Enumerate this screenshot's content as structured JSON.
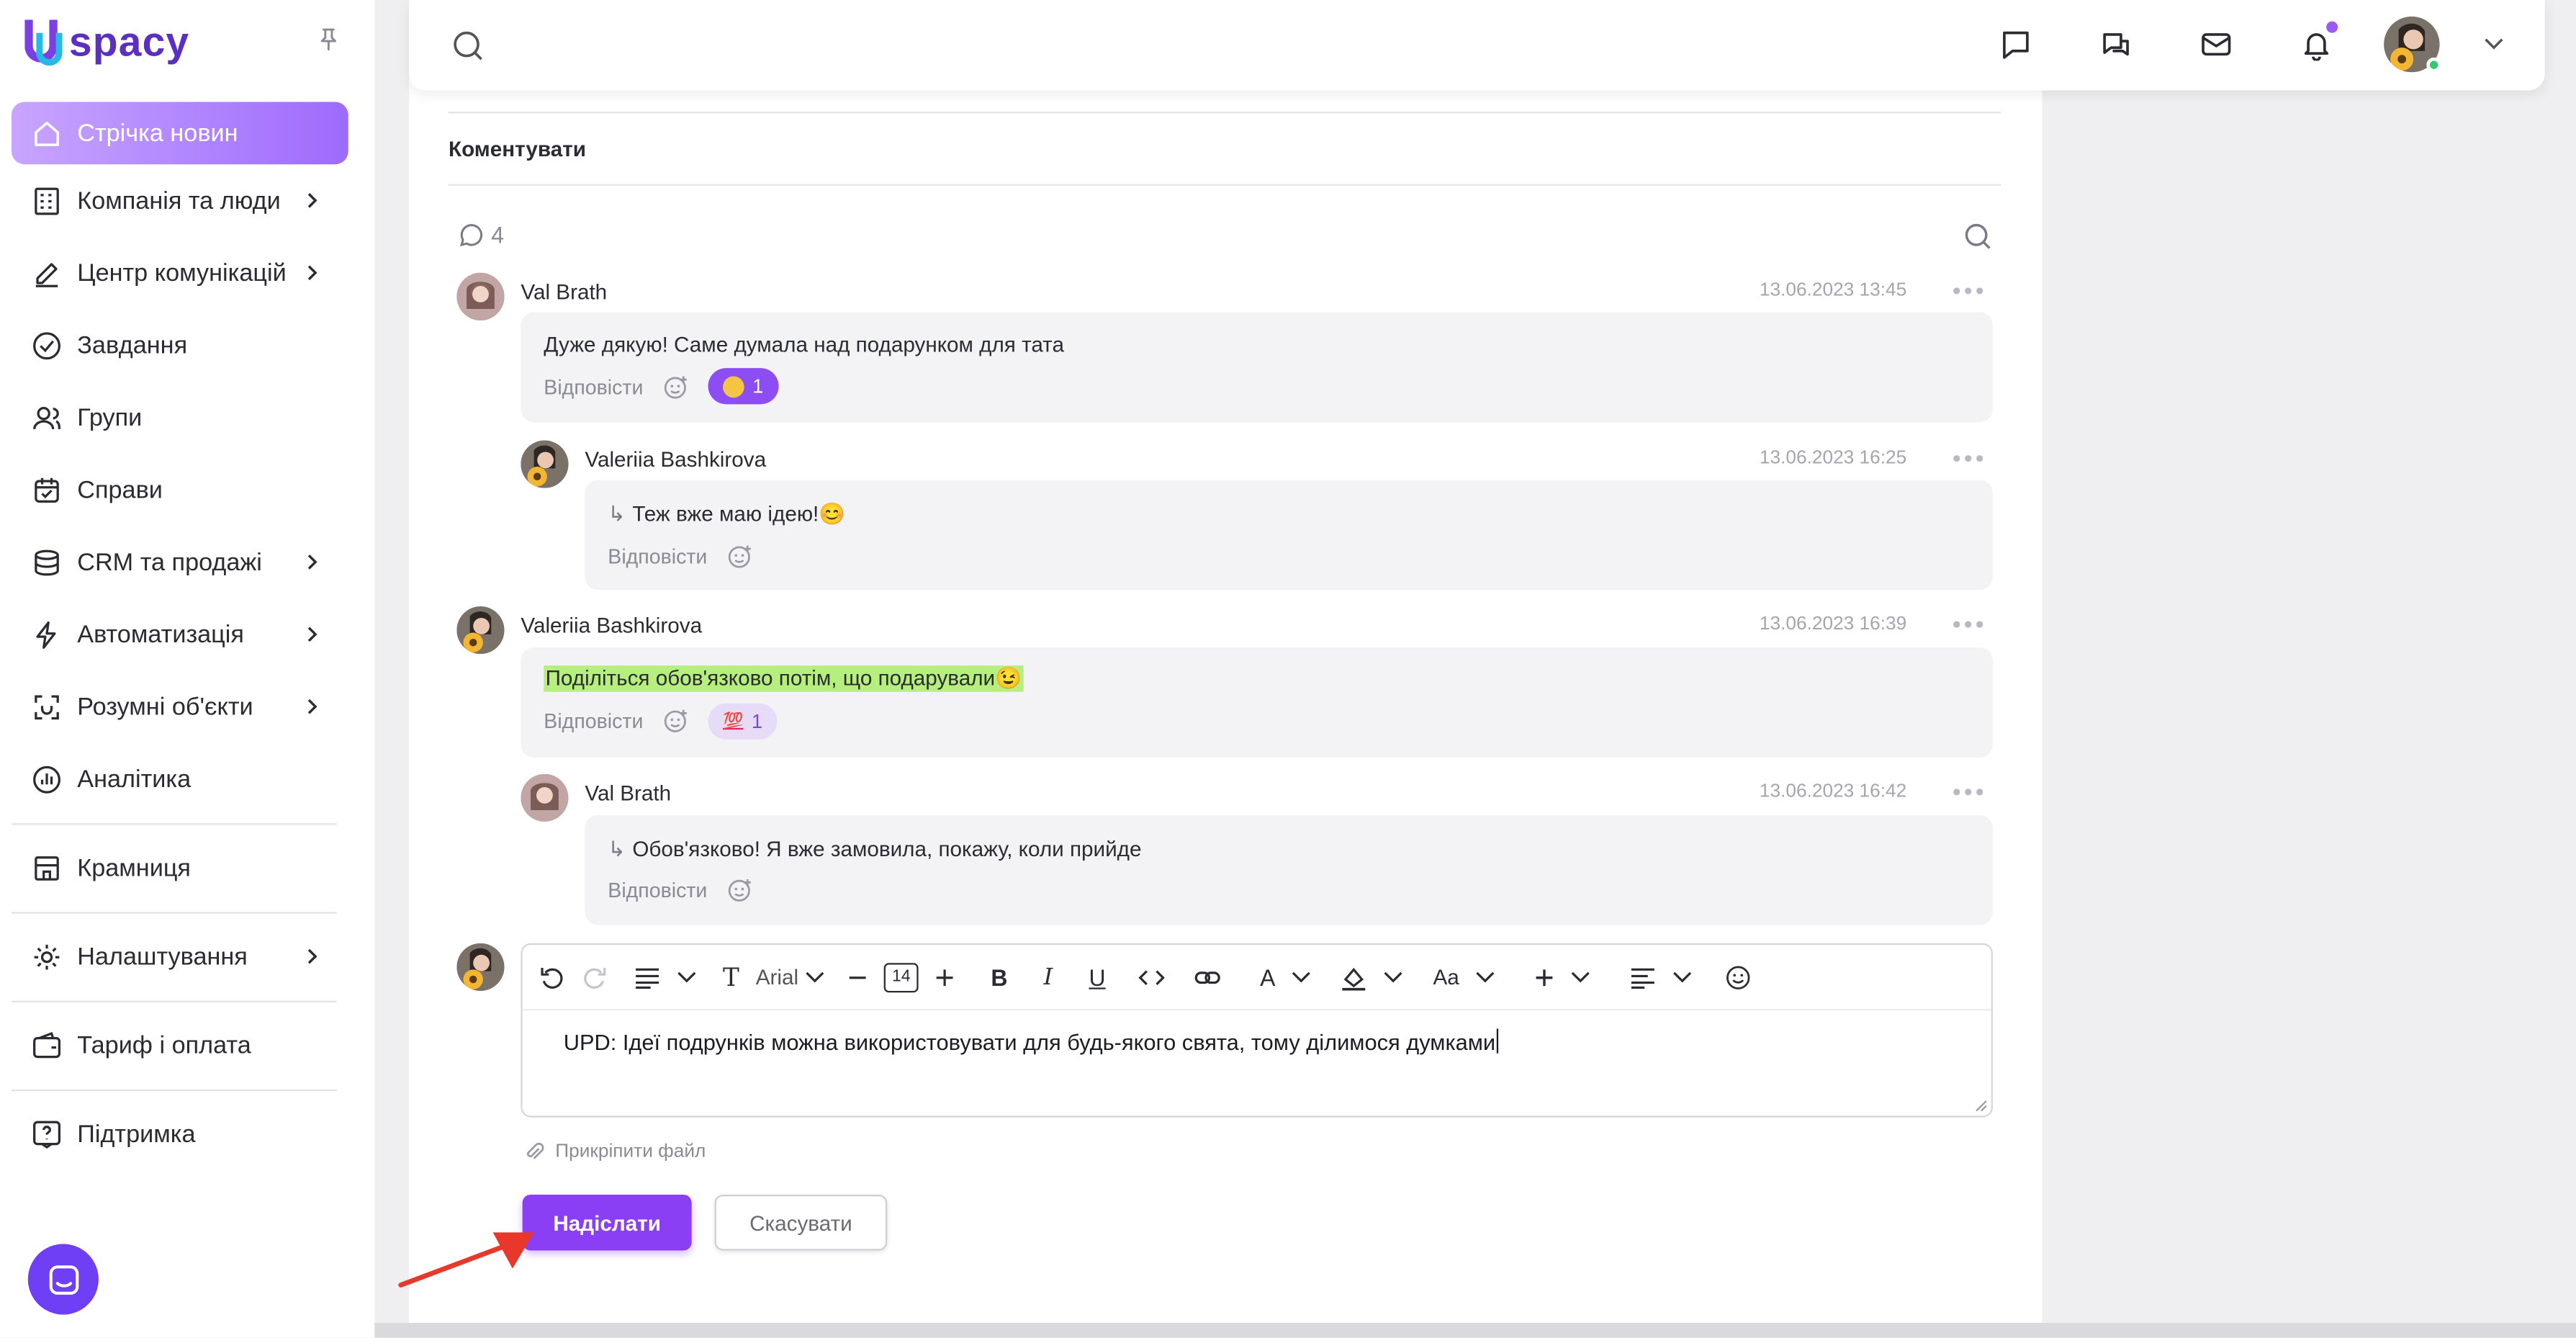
{
  "brand": {
    "name": "spacy"
  },
  "sidebar": {
    "items": [
      {
        "label": "Стрічка новин",
        "icon": "home-icon",
        "active": true
      },
      {
        "label": "Компанія та люди",
        "icon": "building-icon",
        "chevron": true
      },
      {
        "label": "Центр комунікацій",
        "icon": "edit-icon",
        "chevron": true
      },
      {
        "label": "Завдання",
        "icon": "check-circle-icon"
      },
      {
        "label": "Групи",
        "icon": "users-icon"
      },
      {
        "label": "Справи",
        "icon": "calendar-icon"
      },
      {
        "label": "CRM та продажі",
        "icon": "database-icon",
        "chevron": true
      },
      {
        "label": "Автоматизація",
        "icon": "lightning-icon",
        "chevron": true
      },
      {
        "label": "Розумні об'єкти",
        "icon": "scan-icon",
        "chevron": true
      },
      {
        "label": "Аналітика",
        "icon": "chart-icon"
      }
    ],
    "store": "Крамниця",
    "settings": "Налаштування",
    "billing": "Тариф і оплата",
    "support": "Підтримка"
  },
  "comments_section": {
    "title": "Коментувати",
    "count": "4",
    "reply_label": "Відповісти",
    "comments": [
      {
        "author": "Val Brath",
        "date": "13.06.2023 13:45",
        "text": "Дуже дякую! Саме думала над подарунком для тата",
        "reaction_count": "1"
      },
      {
        "author": "Valeriia Bashkirova",
        "date": "13.06.2023 16:25",
        "text": "Теж вже маю ідею!😊"
      },
      {
        "author": "Valeriia Bashkirova",
        "date": "13.06.2023 16:39",
        "text": "Поділіться обов'язково потім, що подарували😉",
        "reaction_count": "1"
      },
      {
        "author": "Val Brath",
        "date": "13.06.2023 16:42",
        "text": "Обов'язково! Я вже замовила, покажу, коли прийде"
      }
    ]
  },
  "editor": {
    "font": "Arial",
    "font_size": "14",
    "case_label": "Aa",
    "text": "UPD: Ідеї подрунків можна використовувати для будь-якого свята, тому ділимося думками"
  },
  "attach_label": "Прикріпити файл",
  "buttons": {
    "send": "Надіслати",
    "cancel": "Скасувати"
  },
  "colors": {
    "accent": "#8b3ff4",
    "active_nav_start": "#c8a5ff",
    "active_nav_end": "#9d6bfd",
    "highlight": "#b6ef7d",
    "arrow": "#e8382c"
  }
}
